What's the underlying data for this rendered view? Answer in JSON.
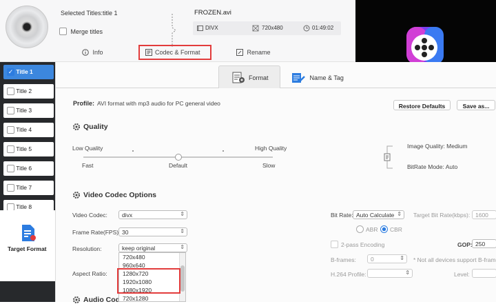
{
  "header": {
    "selected_titles": "Selected Titles:title 1",
    "merge_titles": "Merge titles",
    "file_name": "FROZEN.avi",
    "codec": "DIVX",
    "resolution": "720x480",
    "duration": "01:49:02",
    "tabs": [
      {
        "label": "Info"
      },
      {
        "label": "Codec & Format"
      },
      {
        "label": "Rename"
      }
    ]
  },
  "titles": [
    {
      "label": "Title 1",
      "checked": true
    },
    {
      "label": "Title 2",
      "checked": false
    },
    {
      "label": "Title 3",
      "checked": false
    },
    {
      "label": "Title 4",
      "checked": false
    },
    {
      "label": "Title 5",
      "checked": false
    },
    {
      "label": "Title 6",
      "checked": false
    },
    {
      "label": "Title 7",
      "checked": false
    },
    {
      "label": "Title 8",
      "checked": false
    }
  ],
  "target_format": {
    "label": "Target Format"
  },
  "format_tabs": [
    {
      "label": "Format"
    },
    {
      "label": "Name & Tag"
    }
  ],
  "profile": {
    "label": "Profile:",
    "value": "AVI format with mp3 audio for PC general video"
  },
  "buttons": {
    "restore": "Restore Defaults",
    "save_as": "Save as..."
  },
  "quality": {
    "title": "Quality",
    "low": "Low Quality",
    "high": "High Quality",
    "fast": "Fast",
    "default": "Default",
    "slow": "Slow",
    "image_quality": "Image Quality: Medium",
    "bitrate_mode": "BitRate Mode: Auto"
  },
  "video": {
    "title": "Video Codec Options",
    "codec_label": "Video Codec:",
    "codec_value": "divx",
    "framerate_label": "Frame Rate(FPS):",
    "framerate_value": "30",
    "resolution_label": "Resolution:",
    "resolution_value": "keep original",
    "aspect_label": "Aspect Ratio:",
    "resolution_options": [
      "720x480",
      "960x640",
      "1280x720",
      "1920x1080",
      "1080x1920",
      "720x1280"
    ],
    "bitrate_label": "Bit Rate:",
    "bitrate_value": "Auto Calculate",
    "target_bitrate_label": "Target Bit Rate(kbps):",
    "target_bitrate_value": "1600",
    "abr": "ABR",
    "cbr": "CBR",
    "two_pass": "2-pass Encoding",
    "gop_label": "GOP:",
    "gop_value": "250",
    "bframes_label": "B-frames:",
    "bframes_value": "0",
    "bframes_note": "* Not all devices support B-frame",
    "h264_label": "H.264 Profile:",
    "level_label": "Level:"
  },
  "audio": {
    "title": "Audio Codec"
  }
}
